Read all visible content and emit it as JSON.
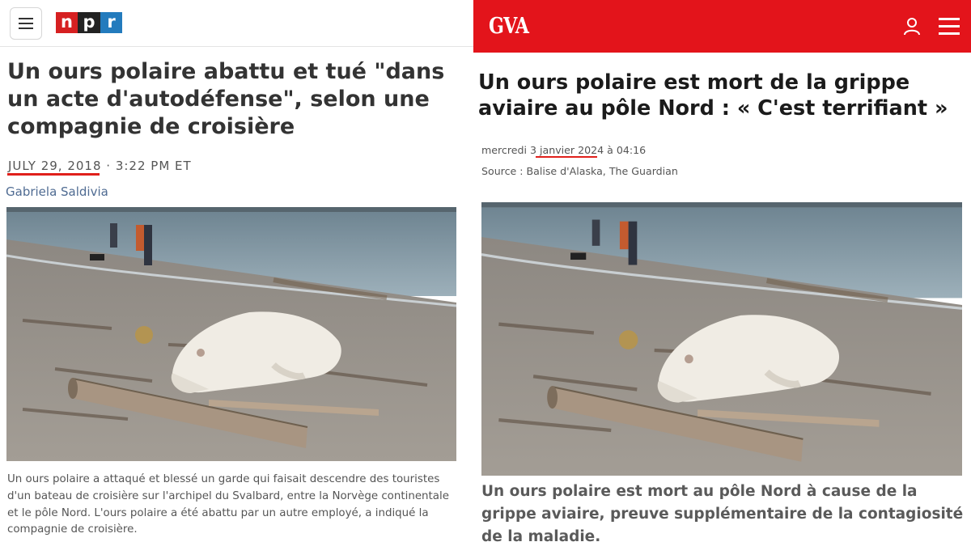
{
  "npr": {
    "logo": {
      "letter_1": "n",
      "letter_2": "p",
      "letter_3": "r"
    },
    "menu_icon": "hamburger-icon",
    "headline": "Un ours polaire abattu et tué \"dans un acte d'autodéfense\", selon une compagnie de croisière",
    "date": "JULY 29, 2018",
    "time": "· 3:22 PM ET",
    "author": "Gabriela Saldivia",
    "photo_subject": "polar-bear-on-beach",
    "caption": "Un ours polaire a attaqué et blessé un garde qui faisait descendre des touristes d'un bateau de croisière sur l'archipel du Svalbard, entre la Norvège continentale et le pôle Nord. L'ours polaire a été abattu par un autre employé, a indiqué la compagnie de croisière.",
    "colors": {
      "logo_red": "#d62021",
      "logo_black": "#222222",
      "logo_blue": "#237bbd",
      "author": "#4f6b92",
      "annotation_underline": "#e0201b"
    }
  },
  "gva": {
    "logo": "GVA",
    "user_icon": "user-icon",
    "menu_icon": "hamburger-icon",
    "headline": "Un ours polaire est mort de la grippe aviaire au pôle Nord : « C'est terrifiant »",
    "meta_prefix": "mercredi",
    "date": "3 janvier 2024",
    "meta_suffix": "à 04:16",
    "source": "Source : Balise d'Alaska, The Guardian",
    "photo_subject": "polar-bear-on-beach",
    "subhead": "Un ours polaire est mort au pôle Nord à cause de la grippe aviaire, preuve supplémentaire de la contagiosité de la maladie.",
    "colors": {
      "header_red": "#e3141b",
      "annotation_underline": "#e0201b"
    }
  }
}
